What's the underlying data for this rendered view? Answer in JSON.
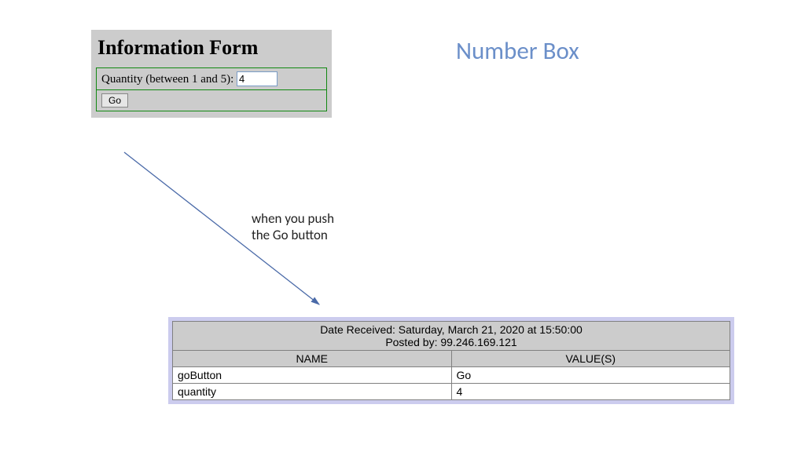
{
  "slide": {
    "title": "Number Box"
  },
  "form": {
    "heading": "Information Form",
    "quantity_label": "Quantity (between 1 and 5):",
    "quantity_value": "4",
    "go_label": "Go"
  },
  "caption": {
    "line1": "when you push",
    "line2": "the Go button"
  },
  "result": {
    "date_received_label": "Date Received:",
    "date_received_value": "Saturday, March 21, 2020 at 15:50:00",
    "posted_by_label": "Posted by:",
    "posted_by_value": "99.246.169.121",
    "col_name": "NAME",
    "col_values": "VALUE(S)",
    "rows": [
      {
        "name": "goButton",
        "value": "Go"
      },
      {
        "name": "quantity",
        "value": "4"
      }
    ]
  }
}
